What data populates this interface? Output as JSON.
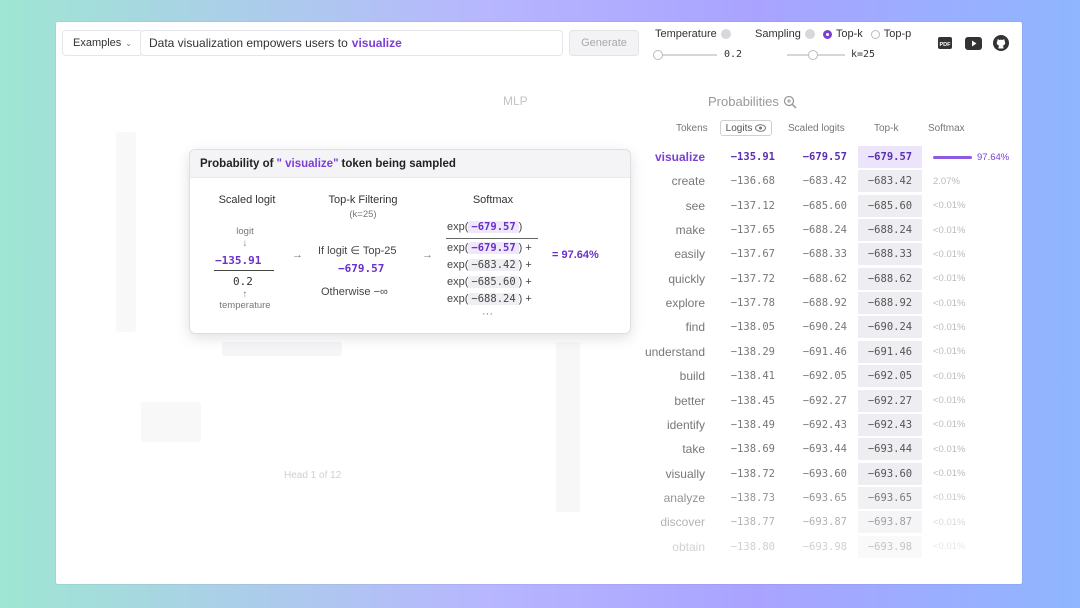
{
  "header": {
    "examples_label": "Examples",
    "prompt_text": "Data visualization empowers users to",
    "prompt_highlight": "visualize",
    "generate_label": "Generate",
    "temperature_label": "Temperature",
    "temperature_value": "0.2",
    "sampling_label": "Sampling",
    "topk_label": "Top-k",
    "topp_label": "Top-p",
    "k_value": "k=25",
    "sampling_selected": "Top-k"
  },
  "background": {
    "mlp_label": "MLP",
    "pager_text": "Head 1 of 12"
  },
  "probabilities": {
    "title": "Probabilities",
    "headers": {
      "tokens": "Tokens",
      "logits": "Logits",
      "scaled": "Scaled logits",
      "topk": "Top-k",
      "softmax": "Softmax"
    },
    "rows": [
      {
        "token": "visualize",
        "logit": "−135.91",
        "scaled": "−679.57",
        "topk": "−679.57",
        "softmax": "97.64%",
        "fraction": 0.9764
      },
      {
        "token": "create",
        "logit": "−136.68",
        "scaled": "−683.42",
        "topk": "−683.42",
        "softmax": "2.07%",
        "fraction": 0.0207
      },
      {
        "token": "see",
        "logit": "−137.12",
        "scaled": "−685.60",
        "topk": "−685.60",
        "softmax": "<0.01%",
        "fraction": 0
      },
      {
        "token": "make",
        "logit": "−137.65",
        "scaled": "−688.24",
        "topk": "−688.24",
        "softmax": "<0.01%",
        "fraction": 0
      },
      {
        "token": "easily",
        "logit": "−137.67",
        "scaled": "−688.33",
        "topk": "−688.33",
        "softmax": "<0.01%",
        "fraction": 0
      },
      {
        "token": "quickly",
        "logit": "−137.72",
        "scaled": "−688.62",
        "topk": "−688.62",
        "softmax": "<0.01%",
        "fraction": 0
      },
      {
        "token": "explore",
        "logit": "−137.78",
        "scaled": "−688.92",
        "topk": "−688.92",
        "softmax": "<0.01%",
        "fraction": 0
      },
      {
        "token": "find",
        "logit": "−138.05",
        "scaled": "−690.24",
        "topk": "−690.24",
        "softmax": "<0.01%",
        "fraction": 0
      },
      {
        "token": "understand",
        "logit": "−138.29",
        "scaled": "−691.46",
        "topk": "−691.46",
        "softmax": "<0.01%",
        "fraction": 0
      },
      {
        "token": "build",
        "logit": "−138.41",
        "scaled": "−692.05",
        "topk": "−692.05",
        "softmax": "<0.01%",
        "fraction": 0
      },
      {
        "token": "better",
        "logit": "−138.45",
        "scaled": "−692.27",
        "topk": "−692.27",
        "softmax": "<0.01%",
        "fraction": 0
      },
      {
        "token": "identify",
        "logit": "−138.49",
        "scaled": "−692.43",
        "topk": "−692.43",
        "softmax": "<0.01%",
        "fraction": 0
      },
      {
        "token": "take",
        "logit": "−138.69",
        "scaled": "−693.44",
        "topk": "−693.44",
        "softmax": "<0.01%",
        "fraction": 0
      },
      {
        "token": "visually",
        "logit": "−138.72",
        "scaled": "−693.60",
        "topk": "−693.60",
        "softmax": "<0.01%",
        "fraction": 0
      },
      {
        "token": "analyze",
        "logit": "−138.73",
        "scaled": "−693.65",
        "topk": "−693.65",
        "softmax": "<0.01%",
        "fraction": 0
      },
      {
        "token": "discover",
        "logit": "−138.77",
        "scaled": "−693.87",
        "topk": "−693.87",
        "softmax": "<0.01%",
        "fraction": 0
      },
      {
        "token": "obtain",
        "logit": "−138.80",
        "scaled": "−693.98",
        "topk": "−693.98",
        "softmax": "<0.01%",
        "fraction": 0
      }
    ]
  },
  "popup": {
    "title_prefix": "Probability of",
    "token": "\" visualize\"",
    "title_suffix": "token being sampled",
    "col1_title": "Scaled logit",
    "logit_label": "logit",
    "logit_value": "−135.91",
    "temperature_value": "0.2",
    "temperature_label": "temperature",
    "col2_title": "Top-k Filtering",
    "col2_sub": "(k=25)",
    "if_text": "If logit ∈ Top-25",
    "if_value": "−679.57",
    "otherwise_text": "Otherwise −∞",
    "col3_title": "Softmax",
    "exp_label": "exp(",
    "exp_close": ")",
    "plus": "+",
    "numerator": "−679.57",
    "denominator": [
      "−679.57",
      "−683.42",
      "−685.60",
      "−688.24"
    ],
    "ellipsis": "···",
    "result": "= 97.64%",
    "arrow": "→",
    "down_arrow": "↓",
    "up_arrow": "↑"
  },
  "colors": {
    "accent": "#7b3fd6",
    "frame_border": "#a9a3ff"
  },
  "icons": [
    "pdf-icon",
    "youtube-icon",
    "github-icon",
    "zoom-icon",
    "eye-icon",
    "chevron-down-icon"
  ]
}
